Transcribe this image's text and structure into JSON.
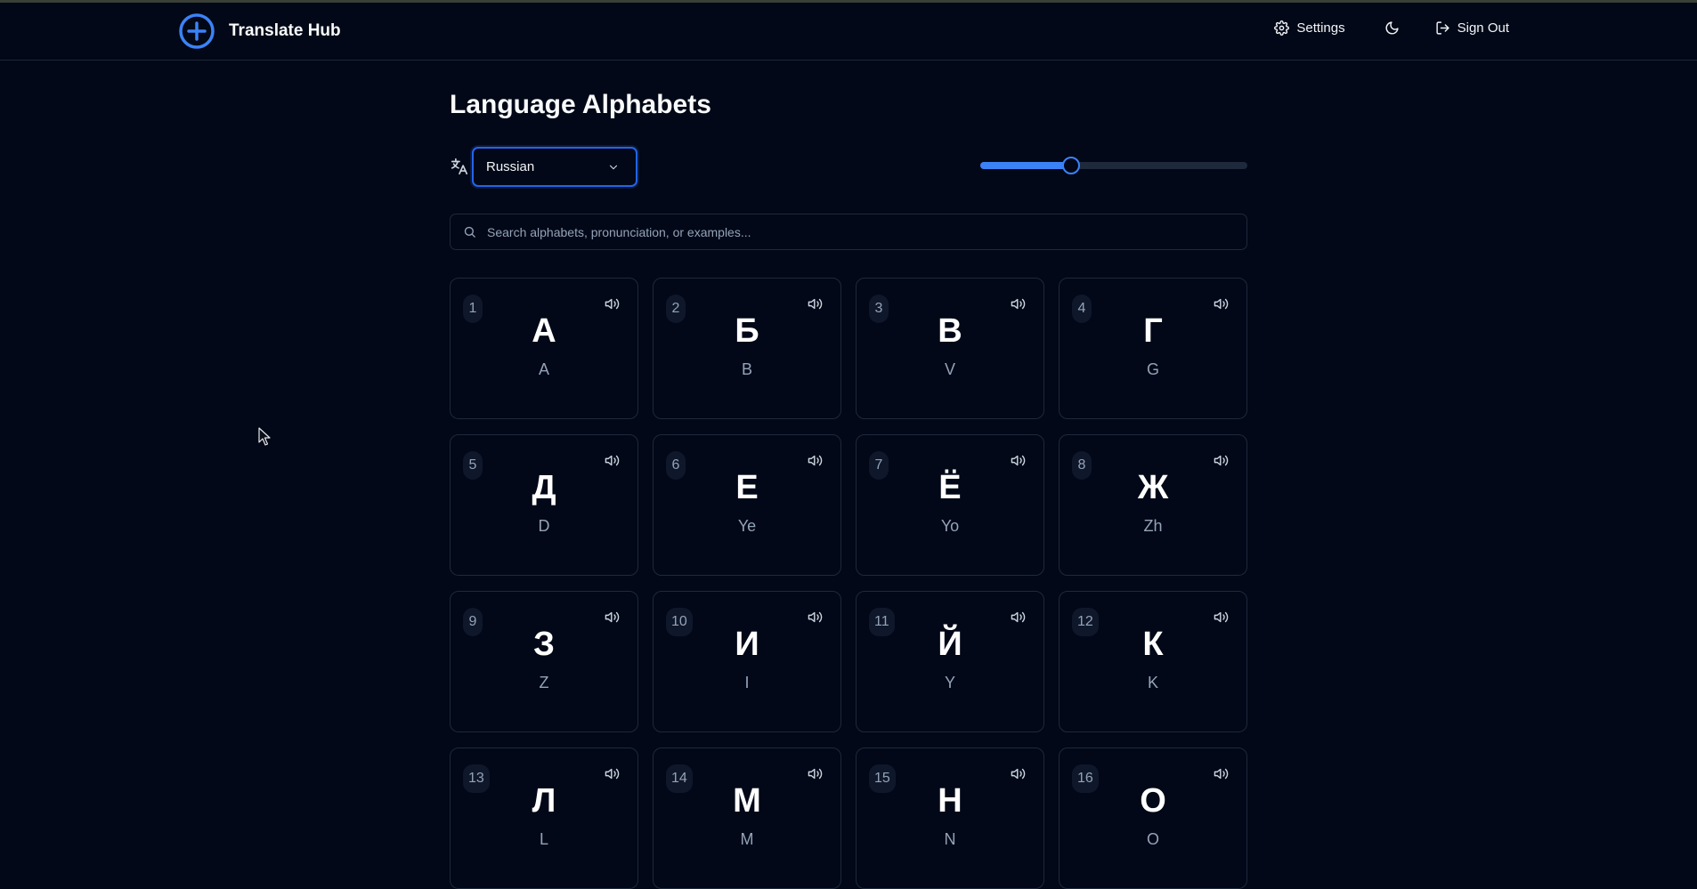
{
  "app": {
    "title": "Translate Hub"
  },
  "nav": {
    "settings_label": "Settings",
    "signout_label": "Sign Out"
  },
  "page": {
    "title": "Language Alphabets"
  },
  "language_select": {
    "value": "Russian"
  },
  "slider": {
    "value": 0.34
  },
  "search": {
    "placeholder": "Search alphabets, pronunciation, or examples..."
  },
  "icons": {
    "brand": "plus-circle-icon",
    "settings": "gear-icon",
    "theme": "moon-icon",
    "signout": "sign-out-icon",
    "language": "translate-icon",
    "chevron": "chevron-down-icon",
    "search": "search-icon",
    "sound": "speaker-icon"
  },
  "colors": {
    "accent": "#3b82f6",
    "background": "#020817",
    "border": "#1e293b"
  },
  "letters": [
    {
      "num": "1",
      "letter": "А",
      "translit": "A"
    },
    {
      "num": "2",
      "letter": "Б",
      "translit": "B"
    },
    {
      "num": "3",
      "letter": "В",
      "translit": "V"
    },
    {
      "num": "4",
      "letter": "Г",
      "translit": "G"
    },
    {
      "num": "5",
      "letter": "Д",
      "translit": "D"
    },
    {
      "num": "6",
      "letter": "Е",
      "translit": "Ye"
    },
    {
      "num": "7",
      "letter": "Ё",
      "translit": "Yo"
    },
    {
      "num": "8",
      "letter": "Ж",
      "translit": "Zh"
    },
    {
      "num": "9",
      "letter": "З",
      "translit": "Z"
    },
    {
      "num": "10",
      "letter": "И",
      "translit": "I"
    },
    {
      "num": "11",
      "letter": "Й",
      "translit": "Y"
    },
    {
      "num": "12",
      "letter": "К",
      "translit": "K"
    },
    {
      "num": "13",
      "letter": "Л",
      "translit": "L"
    },
    {
      "num": "14",
      "letter": "М",
      "translit": "M"
    },
    {
      "num": "15",
      "letter": "Н",
      "translit": "N"
    },
    {
      "num": "16",
      "letter": "О",
      "translit": "O"
    }
  ]
}
